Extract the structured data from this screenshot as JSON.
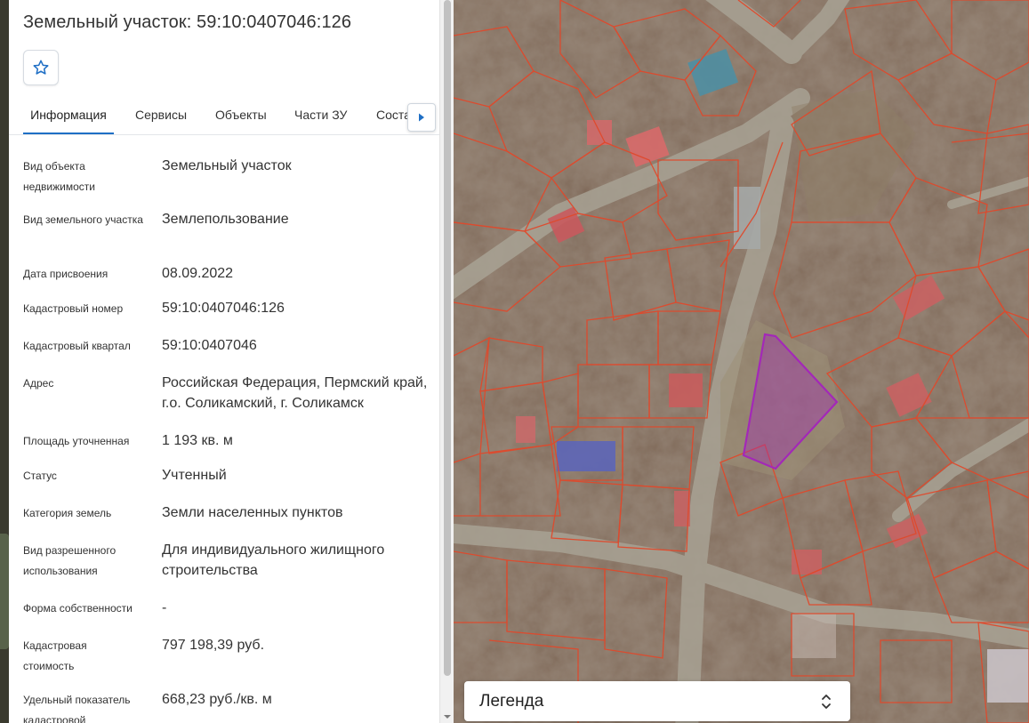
{
  "header": {
    "title": "Земельный участок: 59:10:0407046:126",
    "favorite_icon": "star-outline-icon"
  },
  "tabs": [
    {
      "label": "Информация",
      "active": true
    },
    {
      "label": "Сервисы",
      "active": false
    },
    {
      "label": "Объекты",
      "active": false
    },
    {
      "label": "Части ЗУ",
      "active": false
    },
    {
      "label": "Состав ЗУ",
      "active": false
    }
  ],
  "tabs_scroll_icon": "triangle-right-icon",
  "info": [
    {
      "label": "Вид объекта недвижимости",
      "value": "Земельный участок"
    },
    {
      "label": "Вид земельного участка",
      "value": "Землепользование"
    },
    {
      "label": "Дата присвоения",
      "value": "08.09.2022"
    },
    {
      "label": "Кадастровый номер",
      "value": "59:10:0407046:126"
    },
    {
      "label": "Кадастровый квартал",
      "value": "59:10:0407046"
    },
    {
      "label": "Адрес",
      "value": "Российская Федерация, Пермский край, г.о. Соликамский, г. Соликамск"
    },
    {
      "label": "Площадь уточненная",
      "value": "1 193 кв. м"
    },
    {
      "label": "Статус",
      "value": "Учтенный"
    },
    {
      "label": "Категория земель",
      "value": "Земли населенных пунктов"
    },
    {
      "label": "Вид разрешенного использования",
      "value": "Для индивидуального жилищного строительства"
    },
    {
      "label": "Форма собственности",
      "value": "-"
    },
    {
      "label": "Кадастровая стоимость",
      "value": "797 198,39 руб."
    },
    {
      "label": "Удельный показатель кадастровой",
      "value": "668,23 руб./кв. м"
    }
  ],
  "legend": {
    "label": "Легенда",
    "icon": "chevron-up-down-icon"
  },
  "colors": {
    "accent": "#1f6fc5",
    "parcel_border": "#e0492c",
    "selected_parcel": "#a328b8"
  }
}
